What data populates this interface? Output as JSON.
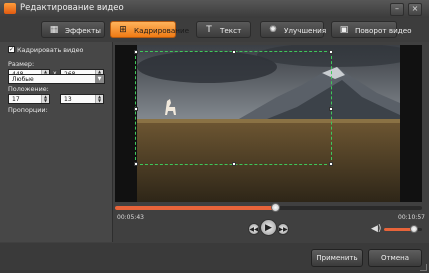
{
  "window": {
    "title": "Редактирование видео",
    "controls": [
      "minimize-icon",
      "close-icon"
    ]
  },
  "toolbar": {
    "tabs": [
      {
        "label": "Эффекты",
        "icon": "film-effects-icon",
        "active": false
      },
      {
        "label": "Кадрирование",
        "icon": "crop-icon",
        "active": true
      },
      {
        "label": "Текст",
        "icon": "text-icon",
        "active": false
      },
      {
        "label": "Улучшения",
        "icon": "enhance-icon",
        "active": false
      },
      {
        "label": "Поворот видео",
        "icon": "rotate-icon",
        "active": false
      }
    ],
    "active_color": "#f28a1e"
  },
  "crop_panel": {
    "checkbox_label": "Кадрировать видео",
    "checkbox_checked": true,
    "size_label": "Размер:",
    "size_width": "448",
    "size_height": "268",
    "size_separator": "x",
    "position_label": "Положение:",
    "position_x": "17",
    "position_y": "13",
    "ratio_label": "Пропорции:",
    "ratio_value": "Любые"
  },
  "player": {
    "current_time": "00:05:43",
    "total_time": "00:10:57",
    "progress": 0.52,
    "volume": 0.8,
    "crop_border_color": "#3ec85a",
    "seek_color": "#e8643a"
  },
  "actions": {
    "apply_label": "Применить",
    "cancel_label": "Отмена"
  }
}
